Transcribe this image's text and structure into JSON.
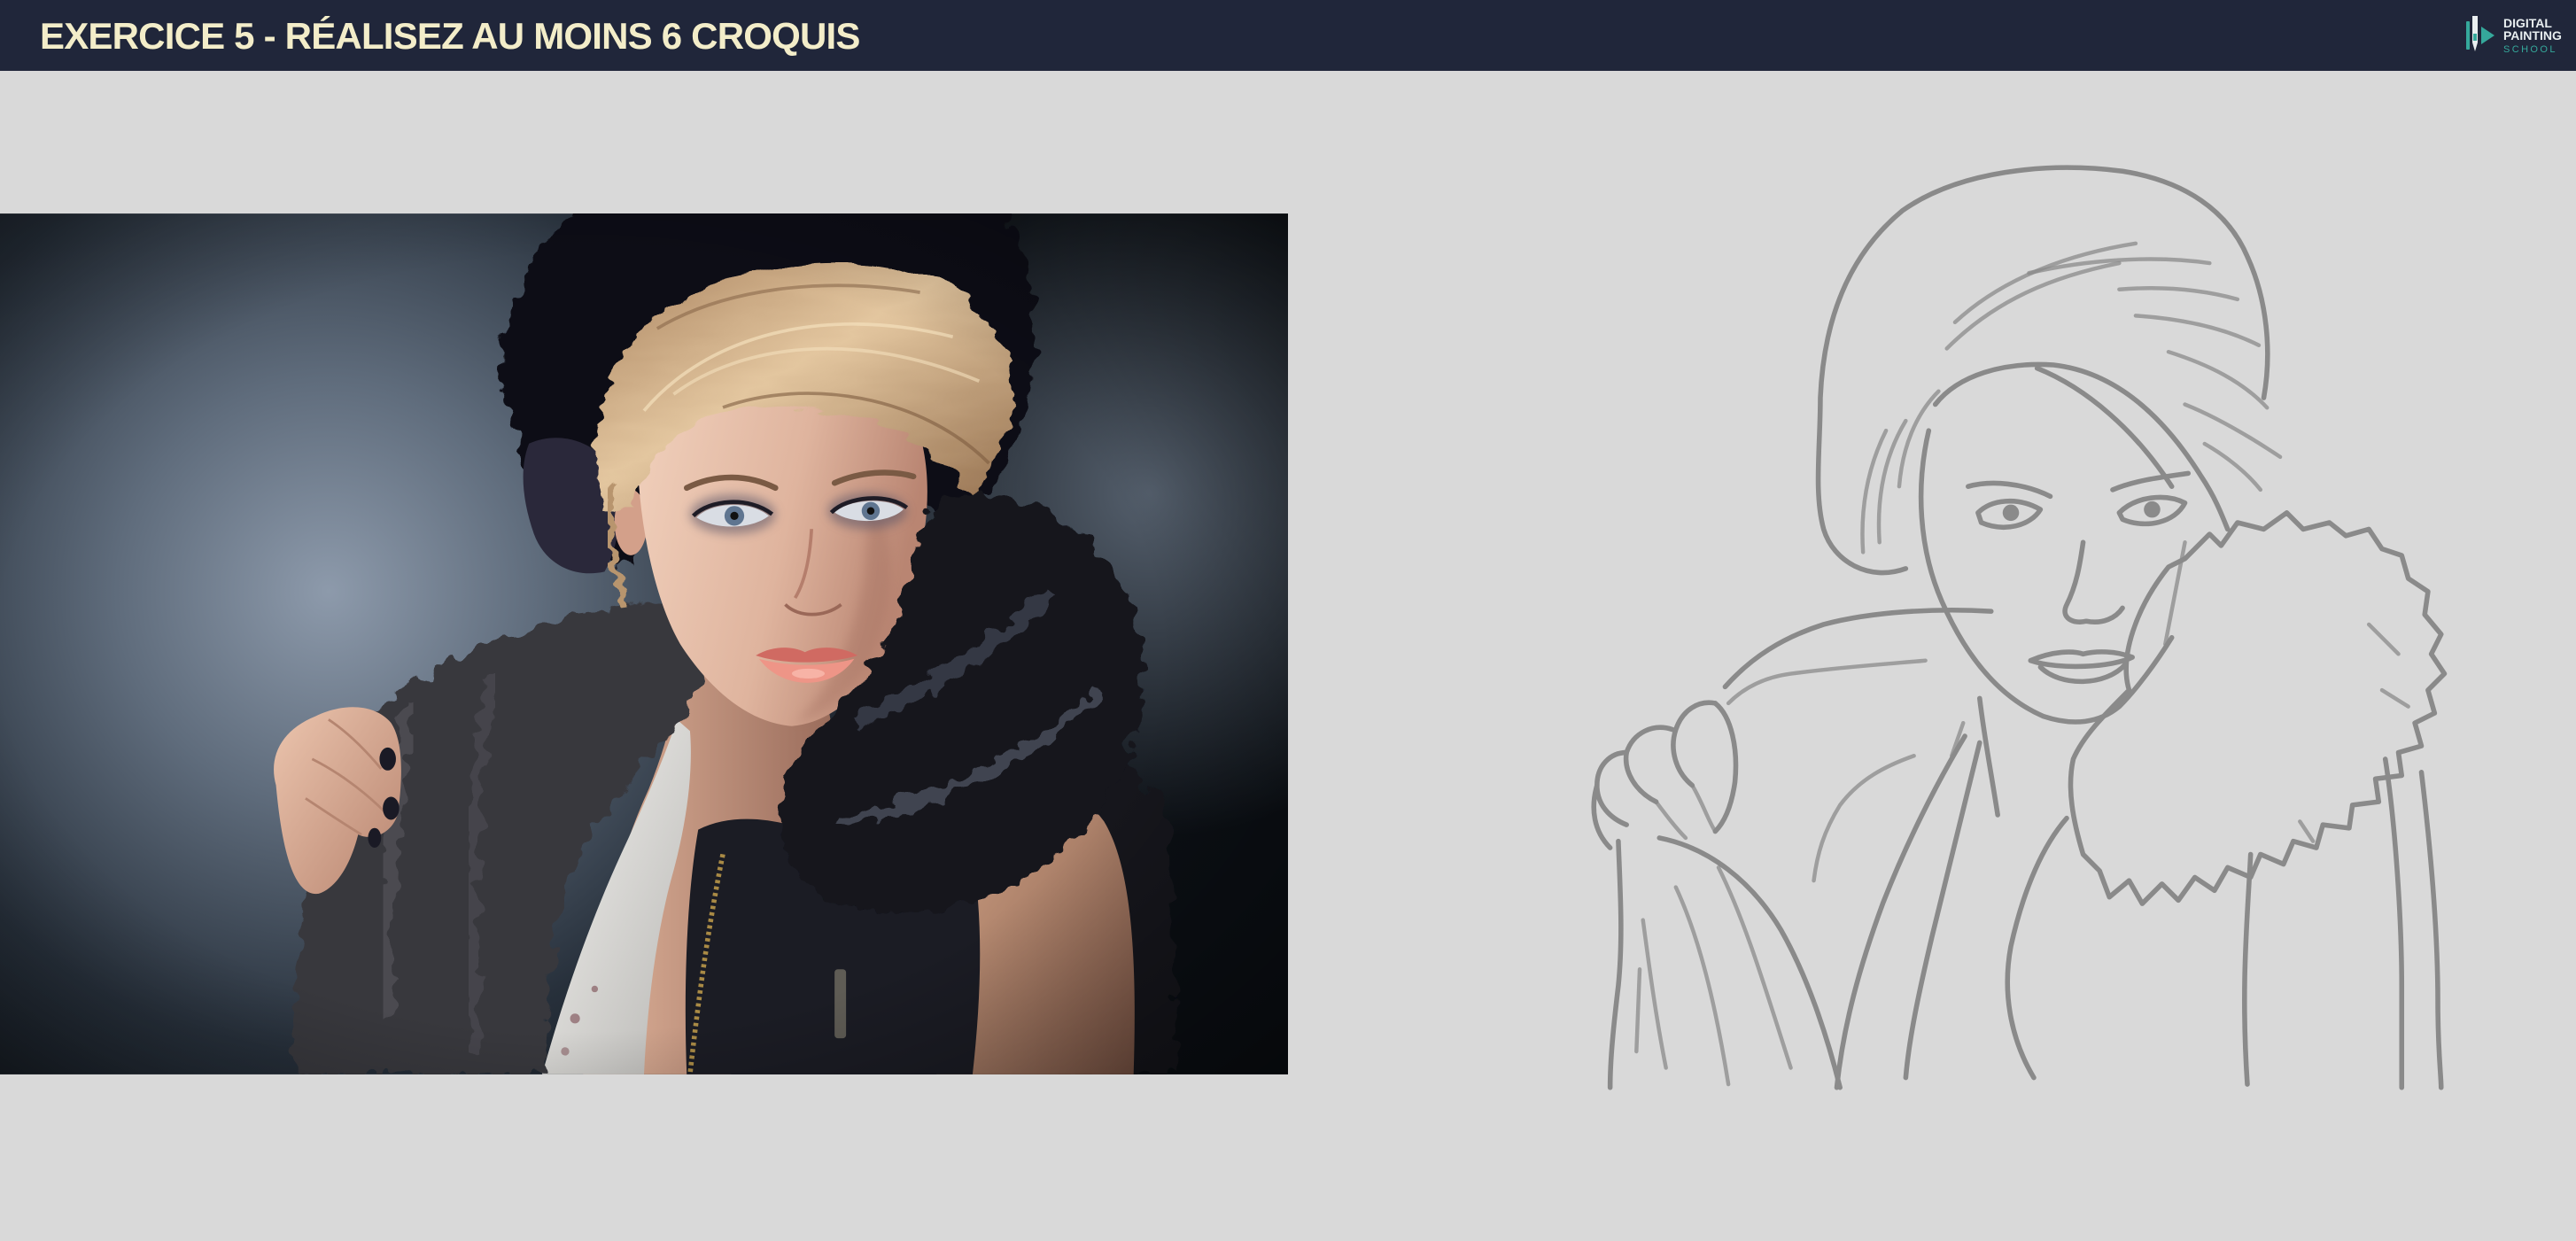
{
  "header": {
    "title": "EXERCICE 5 - RÉALISEZ AU MOINS 6 CROQUIS"
  },
  "logo": {
    "icon": "paintbrush-play-icon",
    "line1": "DIGITAL",
    "line2": "PAINTING",
    "line3": "SCHOOL"
  },
  "colors": {
    "header_background": "#20263a",
    "title_text": "#f3edc9",
    "page_background": "#d9d9d9",
    "logo_text": "#e8eef0",
    "logo_accent": "#35a89b",
    "sketch_stroke": "#8a8a8a"
  }
}
